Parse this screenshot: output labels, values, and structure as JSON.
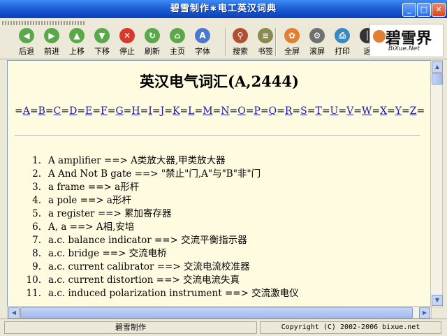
{
  "window": {
    "title": "碧雪制作∗电工英汉词典",
    "min": "_",
    "max": "□",
    "close": "✕"
  },
  "toolbar": {
    "buttons": [
      {
        "label": "后退",
        "glyph": "◀",
        "color": "#5aa84a"
      },
      {
        "label": "前进",
        "glyph": "▶",
        "color": "#5aa84a"
      },
      {
        "label": "上移",
        "glyph": "▲",
        "color": "#5aa84a"
      },
      {
        "label": "下移",
        "glyph": "▼",
        "color": "#5aa84a"
      },
      {
        "label": "停止",
        "glyph": "✕",
        "color": "#d83a2a"
      },
      {
        "label": "刷新",
        "glyph": "↻",
        "color": "#5aa84a"
      },
      {
        "label": "主页",
        "glyph": "⌂",
        "color": "#5aa84a"
      },
      {
        "label": "字体",
        "glyph": "A",
        "color": "#4a7ad0"
      },
      {
        "label": "搜索",
        "glyph": "⚲",
        "color": "#b05030"
      },
      {
        "label": "书签",
        "glyph": "≡",
        "color": "#8a8a50"
      },
      {
        "label": "全屏",
        "glyph": "✿",
        "color": "#e08030"
      },
      {
        "label": "滚屏",
        "glyph": "⚙",
        "color": "#707070"
      },
      {
        "label": "打印",
        "glyph": "⎙",
        "color": "#3a8ac0"
      },
      {
        "label": "退",
        "glyph": "│",
        "color": "#333333"
      }
    ],
    "logo_cn": "碧雪界",
    "logo_en": "BiXue.Net"
  },
  "content": {
    "heading": "英汉电气词汇(A,2444)",
    "alphabet": [
      "A",
      "B",
      "C",
      "D",
      "E",
      "F",
      "G",
      "H",
      "I",
      "J",
      "K",
      "L",
      "M",
      "N",
      "O",
      "P",
      "Q",
      "R",
      "S",
      "T",
      "U",
      "V",
      "W",
      "X",
      "Y",
      "Z"
    ],
    "entries": [
      {
        "n": "1.",
        "text": "A amplifier ==> A类放大器,甲类放大器"
      },
      {
        "n": "2.",
        "text": "A And Not B gate ==> \"禁止\"门,A\"与\"B\"非\"门"
      },
      {
        "n": "3.",
        "text": "a frame ==> a形杆"
      },
      {
        "n": "4.",
        "text": "a pole ==> a形杆"
      },
      {
        "n": "5.",
        "text": "a register ==> 累加寄存器"
      },
      {
        "n": "6.",
        "text": "A, a ==> A相,安培"
      },
      {
        "n": "7.",
        "text": "a.c. balance indicator ==> 交流平衡指示器"
      },
      {
        "n": "8.",
        "text": "a.c. bridge ==> 交流电桥"
      },
      {
        "n": "9.",
        "text": "a.c. current calibrator ==> 交流电流校准器"
      },
      {
        "n": "10.",
        "text": "a.c. current distortion ==> 交流电流失真"
      },
      {
        "n": "11.",
        "text": "a.c. induced polarization instrument ==> 交流激电仪"
      }
    ]
  },
  "statusbar": {
    "left": "碧雪制作",
    "right": "Copyright (C) 2002-2006 bixue.net"
  }
}
